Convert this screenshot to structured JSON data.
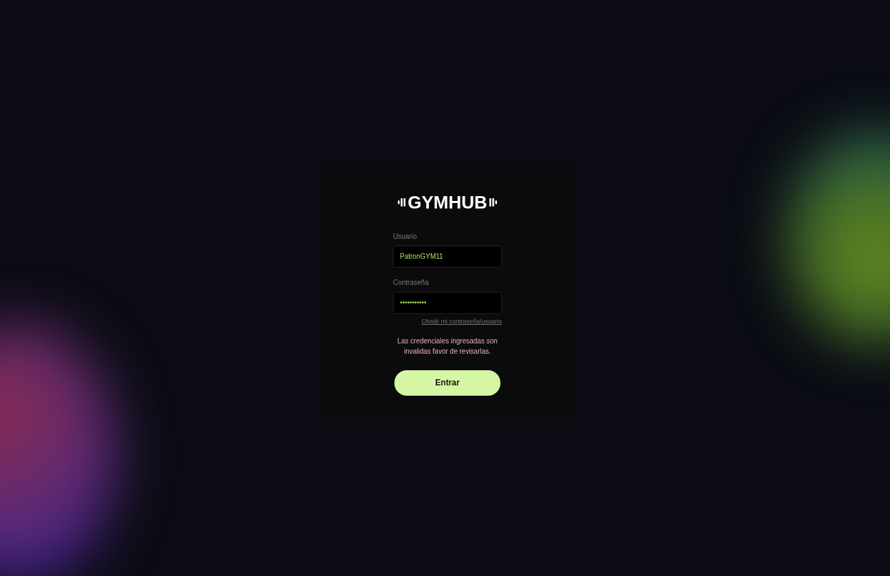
{
  "logo": {
    "text": "GYMHUB"
  },
  "fields": [
    {
      "label": "Usuario",
      "value": "PatronGYM11"
    },
    {
      "label": "Contraseña",
      "value": "•••••••••••"
    }
  ],
  "forgot_link": "Olvidé mi contraseña/usuario",
  "error_message": "Las credenciales ingresadas son invalidas favor de revisarlas.",
  "submit_button": "Entrar"
}
